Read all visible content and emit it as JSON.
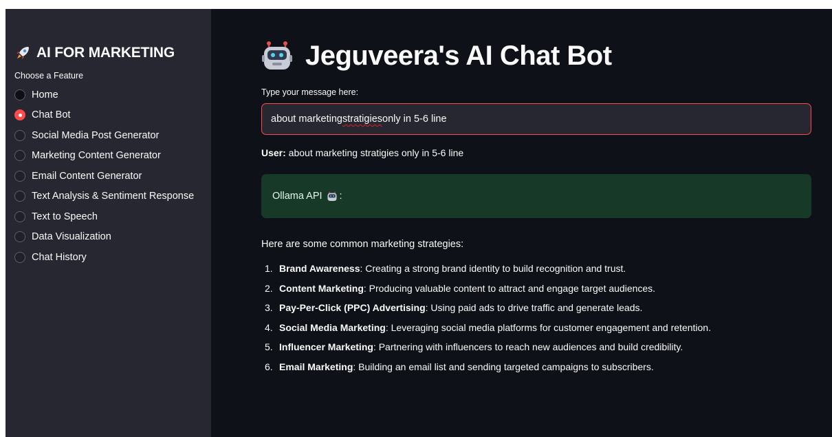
{
  "sidebar": {
    "title": "AI FOR MARKETING",
    "radio_label": "Choose a Feature",
    "items": [
      {
        "label": "Home",
        "selected": false
      },
      {
        "label": "Chat Bot",
        "selected": true
      },
      {
        "label": "Social Media Post Generator",
        "selected": false
      },
      {
        "label": "Marketing Content Generator",
        "selected": false
      },
      {
        "label": "Email Content Generator",
        "selected": false
      },
      {
        "label": "Text Analysis & Sentiment Response",
        "selected": false
      },
      {
        "label": "Text to Speech",
        "selected": false
      },
      {
        "label": "Data Visualization",
        "selected": false
      },
      {
        "label": "Chat History",
        "selected": false
      }
    ]
  },
  "main": {
    "title": "Jeguveera's AI Chat Bot",
    "input_label": "Type your message here:",
    "input_value_before": "about marketing ",
    "input_value_misspelled": "stratigies",
    "input_value_after": " only in 5-6 line",
    "input_value": "about marketing stratigies only in 5-6 line",
    "user_prefix": "User:",
    "user_message": " about marketing stratigies only in 5-6 line",
    "bot_label": "Ollama API",
    "bot_colon": ":",
    "intro": "Here are some common marketing strategies:",
    "strategies": [
      {
        "num": "1.",
        "title": "Brand Awareness",
        "text": ": Creating a strong brand identity to build recognition and trust."
      },
      {
        "num": "2.",
        "title": "Content Marketing",
        "text": ": Producing valuable content to attract and engage target audiences."
      },
      {
        "num": "3.",
        "title": "Pay-Per-Click (PPC) Advertising",
        "text": ": Using paid ads to drive traffic and generate leads."
      },
      {
        "num": "4.",
        "title": "Social Media Marketing",
        "text": ": Leveraging social media platforms for customer engagement and retention."
      },
      {
        "num": "5.",
        "title": "Influencer Marketing",
        "text": ": Partnering with influencers to reach new audiences and build credibility."
      },
      {
        "num": "6.",
        "title": "Email Marketing",
        "text": ": Building an email list and sending targeted campaigns to subscribers."
      }
    ]
  },
  "colors": {
    "sidebar_bg": "#262730",
    "main_bg": "#0e1117",
    "accent": "#ff4b4b",
    "bot_box_bg": "#173928"
  },
  "icons": {
    "sidebar_title": "rocket-icon",
    "page_title": "robot-icon",
    "bot_label": "robot-icon"
  }
}
